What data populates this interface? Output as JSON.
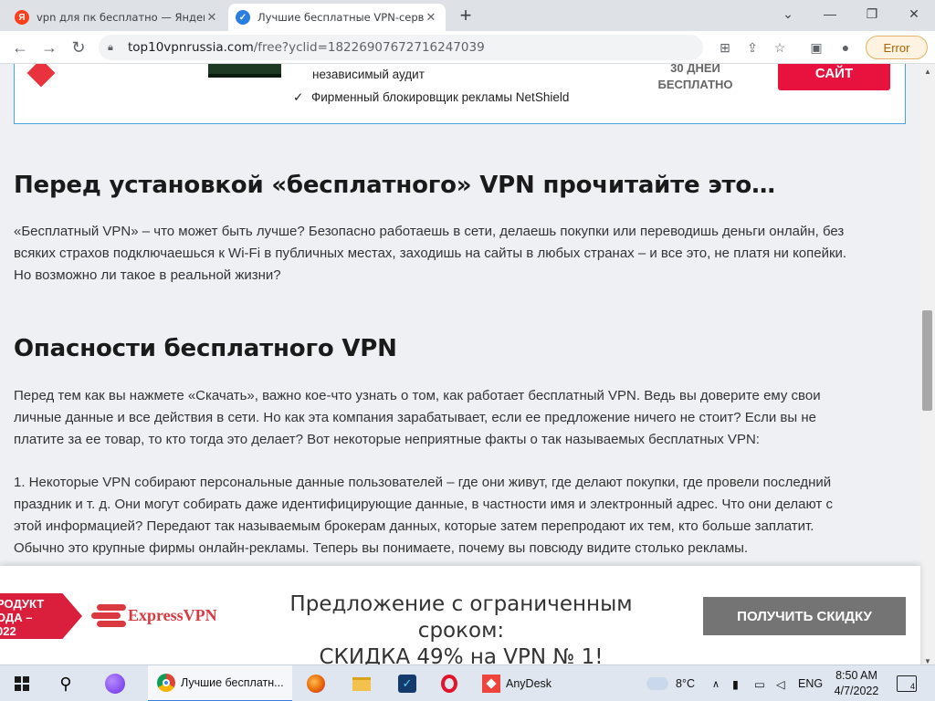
{
  "tabs": [
    {
      "favicon": "Я",
      "favicon_color": "#fc3f1d",
      "title": "vpn для пк бесплатно — Яндекс",
      "close": "✕"
    },
    {
      "favicon": "✓",
      "favicon_color": "#2a7de1",
      "title": "Лучшие бесплатные VPN-серви",
      "close": "✕"
    }
  ],
  "newtab": "+",
  "window": {
    "minimize": "⌄",
    "min": "—",
    "max": "❐",
    "close": "✕"
  },
  "address": {
    "host": "top10vpnrussia.com",
    "path": "/free?yclid=18226907672716247039"
  },
  "error_label": "Error",
  "card": {
    "feature1": "независимый аудит",
    "check": "✓",
    "feature2": "Фирменный блокировщик рекламы NetShield",
    "days1": "30 ДНЕЙ",
    "days2": "БЕСПЛАТНО",
    "cta": "САЙТ"
  },
  "section1": {
    "heading": "Перед установкой «бесплатного» VPN прочитайте это…",
    "lines": [
      "«Бесплатный VPN» – что может быть лучше? Безопасно работаешь в сети, делаешь покупки или переводишь деньги онлайн, без",
      "всяких страхов подключаешься к Wi-Fi в публичных местах, заходишь на сайты в любых странах – и все это, не платя ни копейки.",
      "Но возможно ли такое в реальной жизни?"
    ]
  },
  "section2": {
    "heading": "Опасности бесплатного VPN",
    "lines": [
      "Перед тем как вы нажмете «Скачать», важно кое-что узнать о том, как работает бесплатный VPN. Ведь вы доверите ему свои",
      "личные данные и все действия в сети. Но как эта компания зарабатывает, если ее предложение ничего не стоит? Если вы не",
      "платите за ее товар, то кто тогда это делает? Вот некоторые неприятные факты о так называемых бесплатных VPN:"
    ],
    "item_lines": [
      "1. Некоторые VPN собирают персональные данные пользователей – где они живут, где делают покупки, где провели последний",
      "праздник и т. д. Они могут собирать даже идентифицирующие данные, в частности имя и электронный адрес. Что они делают с",
      "этой информацией? Передают так называемым брокерам данных, которые затем перепродают их тем, кто больше заплатит.",
      "Обычно это крупные фирмы онлайн-рекламы. Теперь вы понимаете, почему вы повсюду видите столько рекламы."
    ]
  },
  "promo": {
    "ribbon": [
      "РОДУКТ",
      "ОДА –",
      "022"
    ],
    "brand": "ExpressVPN",
    "offer1": "Предложение с ограниченным сроком:",
    "offer2": "СКИДКА 49% на VPN № 1!",
    "button": "ПОЛУЧИТЬ СКИДКУ"
  },
  "taskbar": {
    "chrome_title": "Лучшие бесплатн...",
    "anydesk": "AnyDesk",
    "temp": "8°C",
    "lang": "ENG",
    "time": "8:50 AM",
    "date": "4/7/2022",
    "notif": "4"
  }
}
